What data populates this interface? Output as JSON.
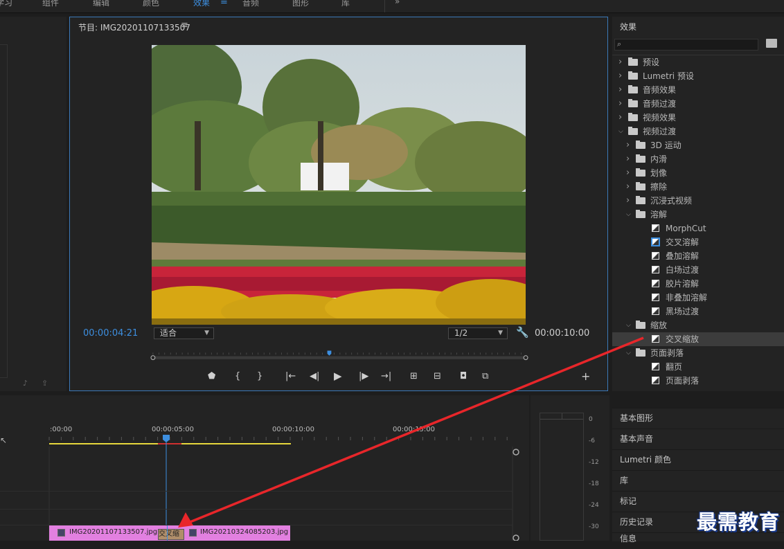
{
  "top_menu": {
    "items": [
      "学习",
      "组件",
      "编辑",
      "颜色",
      "效果",
      "音频",
      "图形",
      "库"
    ],
    "active": "效果",
    "overflow": "»"
  },
  "program_monitor": {
    "title": "节目: IMG20201107133507",
    "menu_icon": "hamburger-icon",
    "timecode_current": "00:00:04:21",
    "timecode_duration": "00:00:10:00",
    "zoom_select": "适合",
    "quality_select": "1/2",
    "playhead_fraction": 0.473
  },
  "effects_panel": {
    "title": "效果",
    "search_placeholder": "",
    "tree": [
      {
        "label": "预设",
        "kind": "starfolder",
        "level": 0,
        "expanded": false
      },
      {
        "label": "Lumetri 预设",
        "kind": "starfolder",
        "level": 0,
        "expanded": false
      },
      {
        "label": "音频效果",
        "kind": "folder",
        "level": 0,
        "expanded": false
      },
      {
        "label": "音频过渡",
        "kind": "folder",
        "level": 0,
        "expanded": false
      },
      {
        "label": "视频效果",
        "kind": "folder",
        "level": 0,
        "expanded": false
      },
      {
        "label": "视频过渡",
        "kind": "folder",
        "level": 0,
        "expanded": true
      },
      {
        "label": "3D 运动",
        "kind": "folder",
        "level": 1,
        "expanded": false
      },
      {
        "label": "内滑",
        "kind": "folder",
        "level": 1,
        "expanded": false
      },
      {
        "label": "划像",
        "kind": "folder",
        "level": 1,
        "expanded": false
      },
      {
        "label": "擦除",
        "kind": "folder",
        "level": 1,
        "expanded": false
      },
      {
        "label": "沉浸式视频",
        "kind": "folder",
        "level": 1,
        "expanded": false
      },
      {
        "label": "溶解",
        "kind": "folder",
        "level": 1,
        "expanded": true
      },
      {
        "label": "MorphCut",
        "kind": "effect",
        "level": 2
      },
      {
        "label": "交叉溶解",
        "kind": "effect",
        "level": 2,
        "highlight": true
      },
      {
        "label": "叠加溶解",
        "kind": "effect",
        "level": 2
      },
      {
        "label": "白场过渡",
        "kind": "effect",
        "level": 2
      },
      {
        "label": "胶片溶解",
        "kind": "effect",
        "level": 2
      },
      {
        "label": "非叠加溶解",
        "kind": "effect",
        "level": 2
      },
      {
        "label": "黑场过渡",
        "kind": "effect",
        "level": 2
      },
      {
        "label": "缩放",
        "kind": "folder",
        "level": 1,
        "expanded": true
      },
      {
        "label": "交叉缩放",
        "kind": "effect",
        "level": 2,
        "selected": true
      },
      {
        "label": "页面剥落",
        "kind": "folder",
        "level": 1,
        "expanded": true
      },
      {
        "label": "翻页",
        "kind": "effect",
        "level": 2
      },
      {
        "label": "页面剥落",
        "kind": "effect",
        "level": 2
      }
    ]
  },
  "side_panels": [
    "基本图形",
    "基本声音",
    "Lumetri 颜色",
    "库",
    "标记",
    "历史记录",
    "信息"
  ],
  "timeline": {
    "ruler_labels": [
      ":00:00",
      "00:00:05:00",
      "00:00:10:00",
      "00:00:15:00"
    ],
    "clip_a": "IMG20201107133507.jpg",
    "transition_label": "交叉缩",
    "clip_b": "IMG20210324085203.jpg"
  },
  "audio_meter": {
    "db_labels": [
      "0",
      "-6",
      "-12",
      "-18",
      "-24",
      "-30"
    ]
  },
  "watermark": "最需教育",
  "colors": {
    "accent_blue": "#3d8fe0",
    "clip_pink": "#e280e0",
    "arrow_red": "#e8262a",
    "work_area_yellow": "#e6d73c"
  }
}
